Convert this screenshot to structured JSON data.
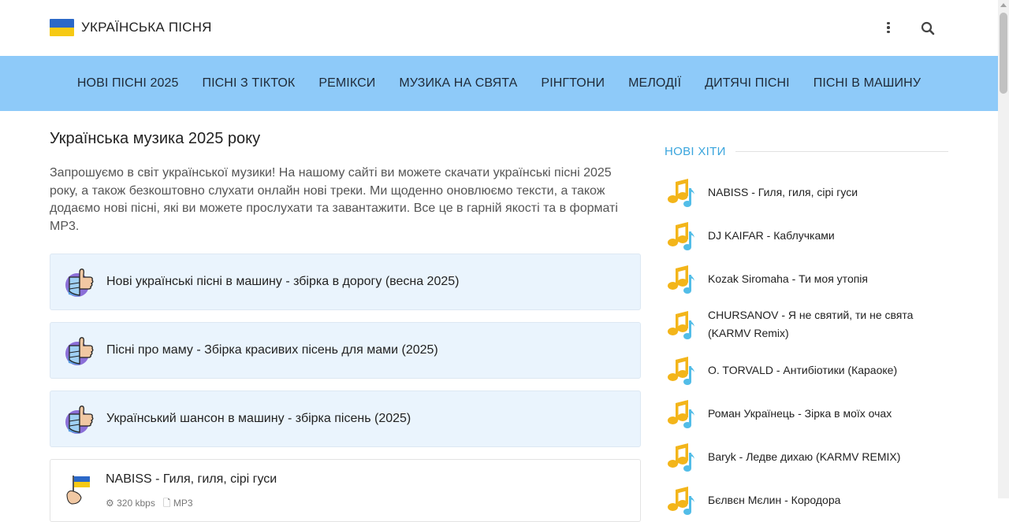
{
  "header": {
    "site_title": "УКРАЇНСЬКА ПІСНЯ",
    "flag_colors": [
      "#2b68c8",
      "#f6c914"
    ],
    "icons": [
      "more-vertical-icon",
      "search-icon"
    ]
  },
  "nav": {
    "items": [
      {
        "label": "НОВІ ПІСНІ 2025"
      },
      {
        "label": "ПІСНІ З ТІКТОК"
      },
      {
        "label": "РЕМІКСИ"
      },
      {
        "label": "МУЗИКА НА СВЯТА"
      },
      {
        "label": "РІНГТОНИ"
      },
      {
        "label": "МЕЛОДІЇ"
      },
      {
        "label": "ДИТЯЧІ ПІСНІ"
      },
      {
        "label": "ПІСНІ В МАШИНУ"
      }
    ],
    "background": "#8ecaf9"
  },
  "main": {
    "heading": "Українська музика 2025 року",
    "intro": "Запрошуємо в світ української музики! На нашому сайті ви можете скачати українські пісні 2025 року, а також безкоштовно слухати онлайн нові треки. Ми щоденно оновлюємо тексти, а також додаємо нові пісні, які ви можете прослухати та завантажити. Все це в гарній якості та в форматі MP3.",
    "collections": [
      {
        "title": "Нові українські пісні в машину - збірка в дорогу (весна 2025)",
        "icon": "thumbs-up-icon"
      },
      {
        "title": "Пісні про маму - Збірка красивих пісень для мами (2025)",
        "icon": "thumbs-up-icon"
      },
      {
        "title": "Український шансон в машину - збірка пісень (2025)",
        "icon": "thumbs-up-icon"
      }
    ],
    "songs": [
      {
        "title": "NABISS - Гиля, гиля, сірі гуси",
        "bitrate": "320 kbps",
        "format": "MP3",
        "icon": "hand-flag-icon"
      }
    ]
  },
  "sidebar": {
    "title": "НОВІ ХІТИ",
    "accent": "#3aa5dd",
    "hits": [
      {
        "name": "NABISS - Гиля, гиля, сірі гуси"
      },
      {
        "name": "DJ KAIFAR - Каблучками"
      },
      {
        "name": "Kozak Siromaha - Ти моя утопія"
      },
      {
        "name": "CHURSANOV - Я не святий, ти не свята (KARMV Remix)"
      },
      {
        "name": "O. TORVALD - Антибіотики (Караоке)"
      },
      {
        "name": "Роман Українець - Зірка в моїх очах"
      },
      {
        "name": "Baryk - Ледве дихаю (KARMV REMIX)"
      },
      {
        "name": "Бєлвєн Мєлин - Кородора"
      }
    ]
  }
}
